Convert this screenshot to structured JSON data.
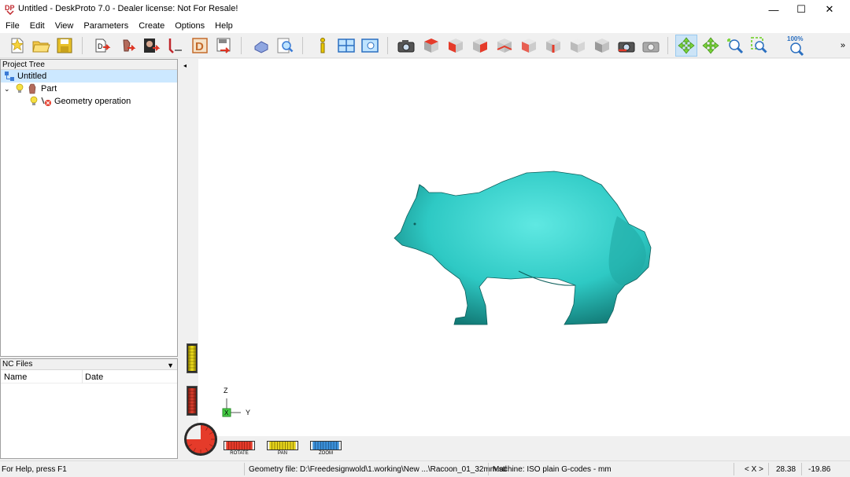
{
  "window": {
    "title": "Untitled - DeskProto 7.0 - Dealer license: Not For Resale!",
    "logo_text": "DP",
    "minimize": "—",
    "maximize": "☐",
    "close": "✕"
  },
  "menu": [
    "File",
    "Edit",
    "View",
    "Parameters",
    "Create",
    "Options",
    "Help"
  ],
  "toolbar": {
    "zoom_100_label": "100%",
    "overflow": "»"
  },
  "project_tree": {
    "header": "Project Tree",
    "items": [
      {
        "label": "Untitled"
      },
      {
        "label": "Part"
      },
      {
        "label": "Geometry operation"
      }
    ]
  },
  "nc_files": {
    "header": "NC Files",
    "dropdown": "▼",
    "columns": [
      "Name",
      "Date"
    ]
  },
  "viewport": {
    "collapse": "◂",
    "controls": [
      "ROTATE",
      "PAN",
      "ZOOM"
    ],
    "axis_labels": {
      "z": "Z",
      "y": "Y",
      "x": "X"
    },
    "colors": {
      "model": "#2ec9c4",
      "axis_origin": "#44cc44",
      "rotate": "#c8382a",
      "pan": "#e4d21c",
      "zoom": "#3a8fd8"
    }
  },
  "status": {
    "help": "For Help, press F1",
    "geometry_file": "Geometry file: D:\\Freedesignwold\\1.working\\New ...\\Racoon_01_32mm.stl",
    "machine": "Machine: ISO plain G-codes - mm",
    "nav": "< X >",
    "coord1": "28.38",
    "coord2": "-19.86"
  }
}
